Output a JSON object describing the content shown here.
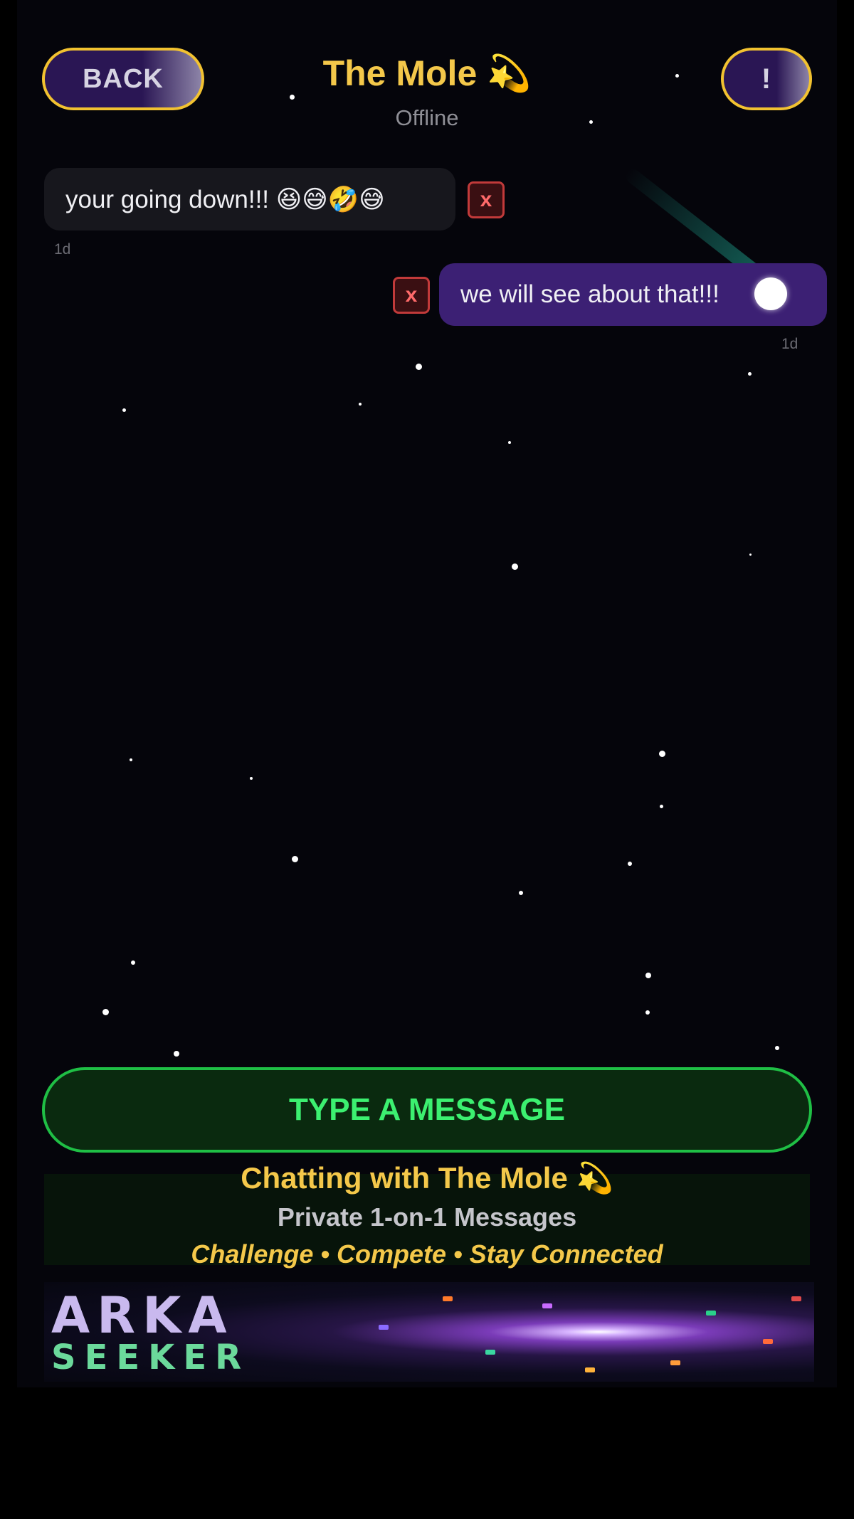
{
  "header": {
    "back_label": "BACK",
    "title": "The Mole 💫",
    "status": "Offline",
    "alert_label": "!"
  },
  "messages": [
    {
      "text": "your going down!!! 😆😅🤣😅",
      "time": "1d",
      "direction": "incoming",
      "delete_label": "x"
    },
    {
      "text": "we will see about that!!!",
      "time": "1d",
      "direction": "outgoing",
      "delete_label": "x"
    }
  ],
  "composer": {
    "label": "TYPE A MESSAGE"
  },
  "info": {
    "title": "Chatting with The Mole 💫",
    "subtitle": "Private 1-on-1 Messages",
    "tagline": "Challenge • Compete • Stay Connected"
  },
  "banner": {
    "line1": "ARKA",
    "line2": "SEEKER"
  },
  "icons": {
    "delete": "close-icon",
    "toggle": "toggle-dot-icon"
  },
  "colors": {
    "accent_gold": "#f4c84a",
    "outgoing_bubble": "#3c2074",
    "incoming_bubble": "#17171d",
    "composer_green": "#1fbf45",
    "delete_red": "#c13a3a"
  }
}
